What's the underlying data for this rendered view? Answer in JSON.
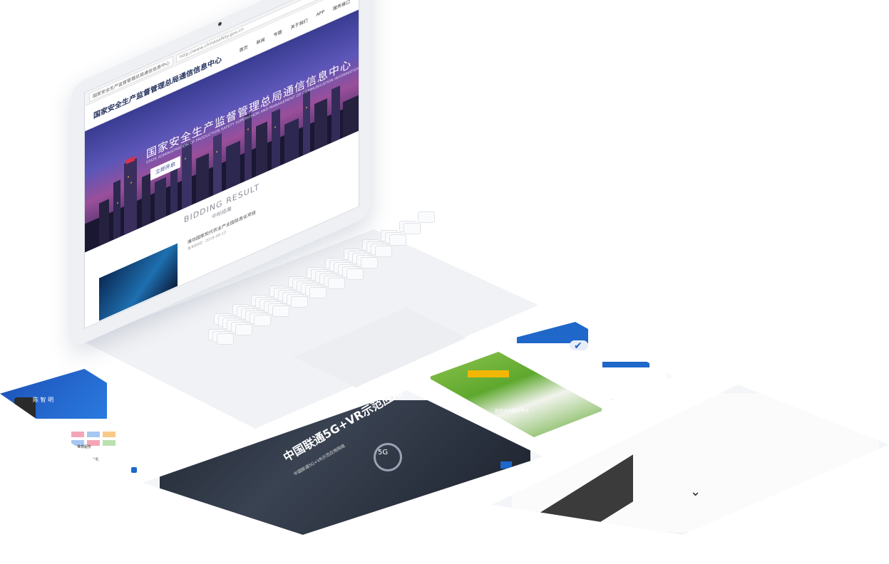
{
  "laptop": {
    "browser": {
      "tab_title": "国家安全生产监督管理总局通信信息中心",
      "address": "http://www.chinasafety.gov.cn"
    },
    "site": {
      "logo_text": "国家安全生产监督管理总局通信信息中心",
      "nav": [
        "首页",
        "新闻",
        "专题",
        "关于我们",
        "APP",
        "服务接口"
      ],
      "hero_title": "国家安全生产监督管理总局通信信息中心",
      "hero_subtitle": "STATE ADMINISTRATION OF PRODUCTION SAFETY SUPERVISION AND MANAGEMENT OF COMMUNICATION INFORMATION CENTER",
      "hero_button": "立即开启",
      "section_title": "BIDDING RESULT",
      "section_subtitle": "中标结果",
      "news_title": "潍坊国家现代农业产业园信息化项目",
      "news_meta": "发布时间：2018-08-12"
    }
  },
  "tablet_center": {
    "headline": "中国联通5G+VR示范应用",
    "caption": "中国联通5G+VR示范应用网络",
    "badge": "5G"
  },
  "phone_left": {
    "profile_name": "陈 智 明",
    "section_labels": [
      "推荐服务",
      "热门资讯"
    ]
  },
  "phone_farm": {
    "title": "现代农业服务平台"
  },
  "tablet_right": {
    "loading_glyph": "⌄"
  },
  "colors": {
    "hero_blue": "#3a3c92",
    "accent_blue": "#1f67c9",
    "farm_green": "#5ea82e",
    "farm_yellow": "#f2b705"
  }
}
